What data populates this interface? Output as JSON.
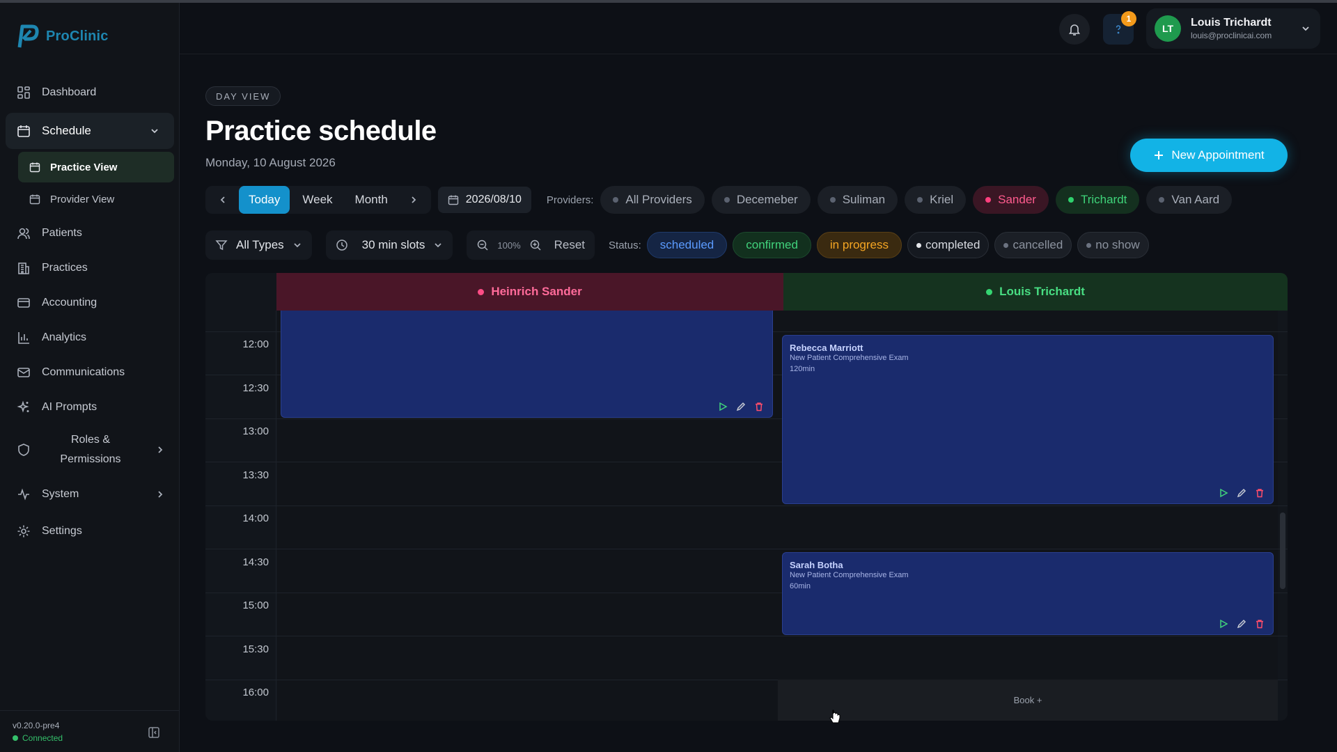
{
  "app": {
    "name": "ProClinic",
    "brand_color": "#1e86b0"
  },
  "sidebar": {
    "items": [
      {
        "label": "Dashboard",
        "icon": "grid-icon"
      },
      {
        "label": "Schedule",
        "icon": "calendar-icon",
        "active": true,
        "expanded": true
      },
      {
        "label": "Practice View",
        "icon": "calendar-icon",
        "sub": true,
        "active": true
      },
      {
        "label": "Provider View",
        "icon": "calendar-icon",
        "sub": true
      },
      {
        "label": "Patients",
        "icon": "users-icon"
      },
      {
        "label": "Practices",
        "icon": "building-icon"
      },
      {
        "label": "Accounting",
        "icon": "card-icon"
      },
      {
        "label": "Analytics",
        "icon": "chart-icon"
      },
      {
        "label": "Communications",
        "icon": "mail-icon"
      },
      {
        "label": "AI Prompts",
        "icon": "sparkles-icon"
      },
      {
        "label_line1": "Roles &",
        "label_line2": "Permissions",
        "icon": "shield-icon"
      },
      {
        "label": "System",
        "icon": "activity-icon"
      },
      {
        "label": "Settings",
        "icon": "gear-icon"
      }
    ],
    "version": "v0.20.0-pre4",
    "connection": "Connected"
  },
  "header": {
    "notifications_icon": "bell-icon",
    "help_badge": "1",
    "user": {
      "initials": "LT",
      "name": "Louis Trichardt",
      "email": "louis@proclinicai.com"
    }
  },
  "page": {
    "view_tag": "DAY VIEW",
    "title": "Practice schedule",
    "date": "Monday, 10 August 2026",
    "new_appointment_label": "New Appointment"
  },
  "toolbar": {
    "today": "Today",
    "week": "Week",
    "month": "Month",
    "date_value": "2026/08/10",
    "providers_label": "Providers:",
    "providers": [
      "All Providers",
      "Decemeber",
      "Suliman",
      "Kriel",
      "Sander",
      "Trichardt",
      "Van Aard"
    ],
    "type_filter": "All Types",
    "slot_size": "30 min slots",
    "zoom": "100%",
    "reset": "Reset",
    "status_label": "Status:",
    "statuses": [
      "scheduled",
      "confirmed",
      "in progress",
      "completed",
      "cancelled",
      "no show"
    ]
  },
  "calendar": {
    "columns": [
      {
        "name": "Heinrich Sander",
        "color": "#ff4d86"
      },
      {
        "name": "Louis Trichardt",
        "color": "#35d672"
      }
    ],
    "times": [
      "12:00",
      "12:30",
      "13:00",
      "13:30",
      "14:00",
      "14:30",
      "15:00",
      "15:30",
      "16:00"
    ],
    "appointments": [
      {
        "patient": "Rebecca Marriott",
        "type": "New Patient Comprehensive Exam",
        "duration": "120min"
      },
      {
        "patient": "Sarah Botha",
        "type": "New Patient Comprehensive Exam",
        "duration": "60min"
      }
    ],
    "book_label": "Book +"
  }
}
